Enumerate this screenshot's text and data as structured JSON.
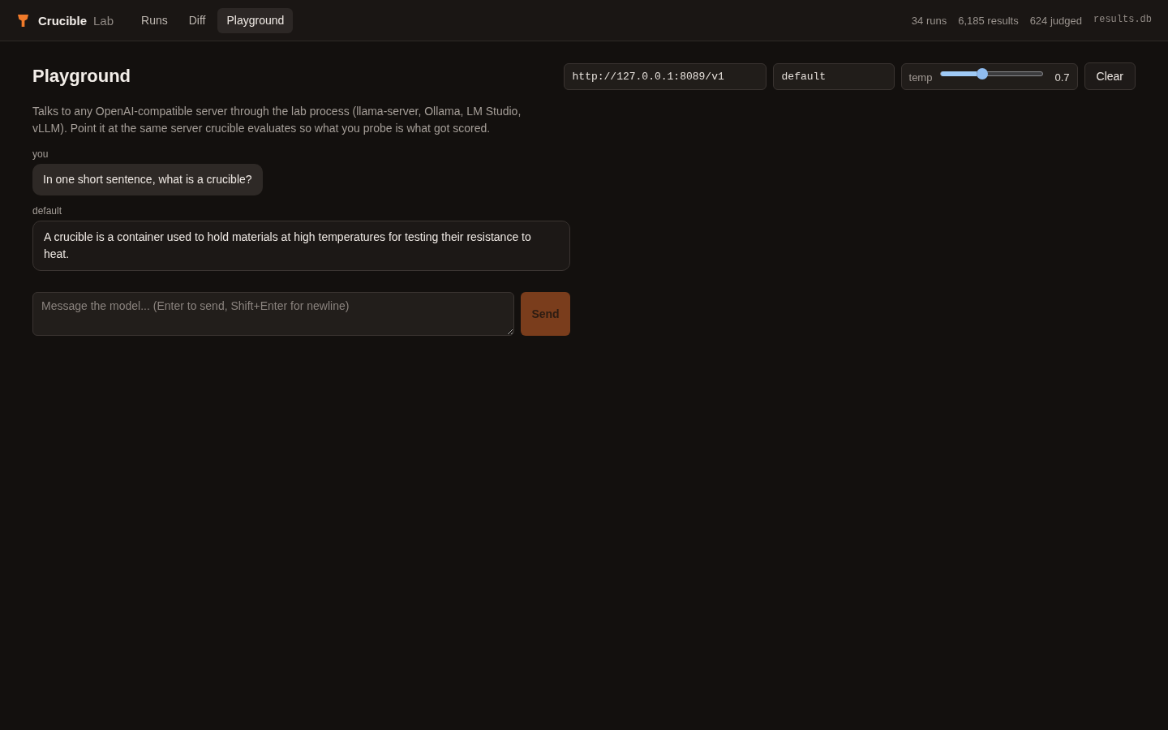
{
  "header": {
    "brand": {
      "name": "Crucible",
      "suffix": "Lab"
    },
    "nav": [
      {
        "label": "Runs",
        "selected": false
      },
      {
        "label": "Diff",
        "selected": false
      },
      {
        "label": "Playground",
        "selected": true
      }
    ],
    "stats": [
      "34 runs",
      "6,185 results",
      "624 judged"
    ],
    "database": "results.db"
  },
  "page": {
    "title": "Playground",
    "description": "Talks to any OpenAI-compatible server through the lab process (llama-server, Ollama, LM Studio, vLLM). Point it at the same server crucible evaluates so what you probe is what got scored."
  },
  "toolbar": {
    "endpoint": {
      "value": "http://127.0.0.1:8089/v1"
    },
    "model": {
      "value": "default"
    },
    "temperature": {
      "label": "temp",
      "level": 0.35,
      "reading": "0.7"
    },
    "clear_button": "Clear"
  },
  "messages": [
    {
      "kind": "user",
      "sender": "you",
      "text": "In one short sentence, what is a crucible?"
    },
    {
      "kind": "assistant",
      "sender": "default",
      "text": "A crucible is a container used to hold materials at high temperatures for testing their resistance to heat."
    }
  ],
  "composer": {
    "placeholder": "Message the model... (Enter to send, Shift+Enter for newline)",
    "send_button": {
      "label": "Send",
      "disabled": true
    }
  }
}
